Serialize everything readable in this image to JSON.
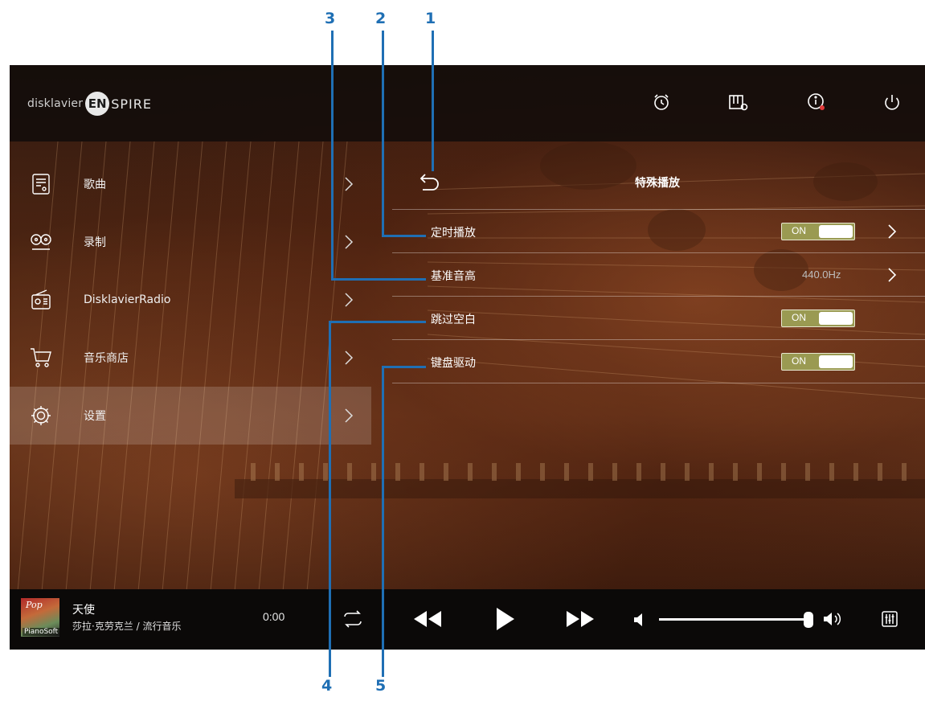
{
  "callouts": [
    "1",
    "2",
    "3",
    "4",
    "5"
  ],
  "brand": {
    "prefix": "disklavier",
    "badge": "EN",
    "suffix": "SPIRE"
  },
  "topbar_icons": [
    "alarm-icon",
    "piano-settings-icon",
    "info-icon",
    "power-icon"
  ],
  "menu": [
    {
      "label": "歌曲",
      "icon": "songs-icon"
    },
    {
      "label": "录制",
      "icon": "record-icon"
    },
    {
      "label": "DisklavierRadio",
      "icon": "radio-icon"
    },
    {
      "label": "音乐商店",
      "icon": "store-icon"
    },
    {
      "label": "设置",
      "icon": "settings-gear-icon",
      "active": true
    }
  ],
  "panel": {
    "title": "特殊播放",
    "rows": [
      {
        "label": "定时播放",
        "toggle": "ON",
        "has_chevron": true
      },
      {
        "label": "基准音高",
        "value": "440.0Hz",
        "has_chevron": true
      },
      {
        "label": "跳过空白",
        "toggle": "ON"
      },
      {
        "label": "键盘驱动",
        "toggle": "ON"
      }
    ]
  },
  "player": {
    "album_genre": "Pop",
    "album_brand": "PianoSoft",
    "song_title": "天使",
    "song_subtitle": "莎拉·克劳克兰 / 流行音乐",
    "time": "0:00",
    "volume": 0.95
  },
  "colors": {
    "callout": "#1f6fb4",
    "toggle_on": "#9a9a52",
    "active_menu_bg": "rgba(255,255,255,0.16)"
  }
}
